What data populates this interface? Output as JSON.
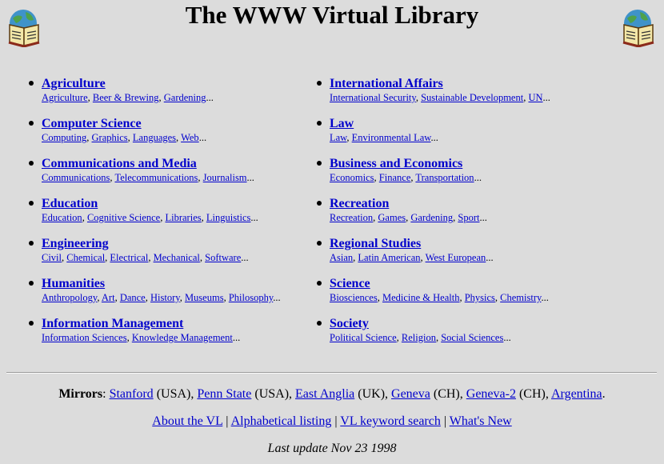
{
  "page": {
    "title": "The WWW Virtual Library"
  },
  "icons": {
    "left": "open-book-globe-icon",
    "right": "open-book-globe-icon"
  },
  "colors": {
    "background": "#dcdcdc",
    "link": "#0000cc"
  },
  "left_column": [
    {
      "title": "Agriculture",
      "subs": [
        "Agriculture",
        "Beer & Brewing",
        "Gardening"
      ]
    },
    {
      "title": "Computer Science",
      "subs": [
        "Computing",
        "Graphics",
        "Languages",
        "Web"
      ]
    },
    {
      "title": "Communications and Media",
      "subs": [
        "Communications",
        "Telecommunications",
        "Journalism"
      ]
    },
    {
      "title": "Education",
      "subs": [
        "Education",
        "Cognitive Science",
        "Libraries",
        "Linguistics"
      ]
    },
    {
      "title": "Engineering",
      "subs": [
        "Civil",
        "Chemical",
        "Electrical",
        "Mechanical",
        "Software"
      ]
    },
    {
      "title": "Humanities",
      "subs": [
        "Anthropology",
        "Art",
        "Dance",
        "History",
        "Museums",
        "Philosophy"
      ]
    },
    {
      "title": "Information Management",
      "subs": [
        "Information Sciences",
        "Knowledge Management"
      ]
    }
  ],
  "right_column": [
    {
      "title": "International Affairs",
      "subs": [
        "International Security",
        "Sustainable Development",
        "UN"
      ]
    },
    {
      "title": "Law",
      "subs": [
        "Law",
        "Environmental Law"
      ]
    },
    {
      "title": "Business and Economics",
      "subs": [
        "Economics",
        "Finance",
        "Transportation"
      ]
    },
    {
      "title": "Recreation",
      "subs": [
        "Recreation",
        "Games",
        "Gardening",
        "Sport"
      ]
    },
    {
      "title": "Regional Studies",
      "subs": [
        "Asian",
        "Latin American",
        "West European"
      ]
    },
    {
      "title": "Science",
      "subs": [
        "Biosciences",
        "Medicine & Health",
        "Physics",
        "Chemistry"
      ]
    },
    {
      "title": "Society",
      "subs": [
        "Political Science",
        "Religion",
        "Social Sciences"
      ]
    }
  ],
  "mirrors": {
    "label": "Mirrors",
    "items": [
      {
        "name": "Stanford",
        "loc": "(USA)"
      },
      {
        "name": "Penn State",
        "loc": "(USA)"
      },
      {
        "name": "East Anglia",
        "loc": "(UK)"
      },
      {
        "name": "Geneva",
        "loc": "(CH)"
      },
      {
        "name": "Geneva-2",
        "loc": "(CH)"
      },
      {
        "name": "Argentina",
        "loc": ""
      }
    ]
  },
  "footer_nav": [
    "About the VL",
    "Alphabetical listing",
    "VL keyword search",
    "What's New"
  ],
  "last_update": "Last update Nov 23 1998"
}
